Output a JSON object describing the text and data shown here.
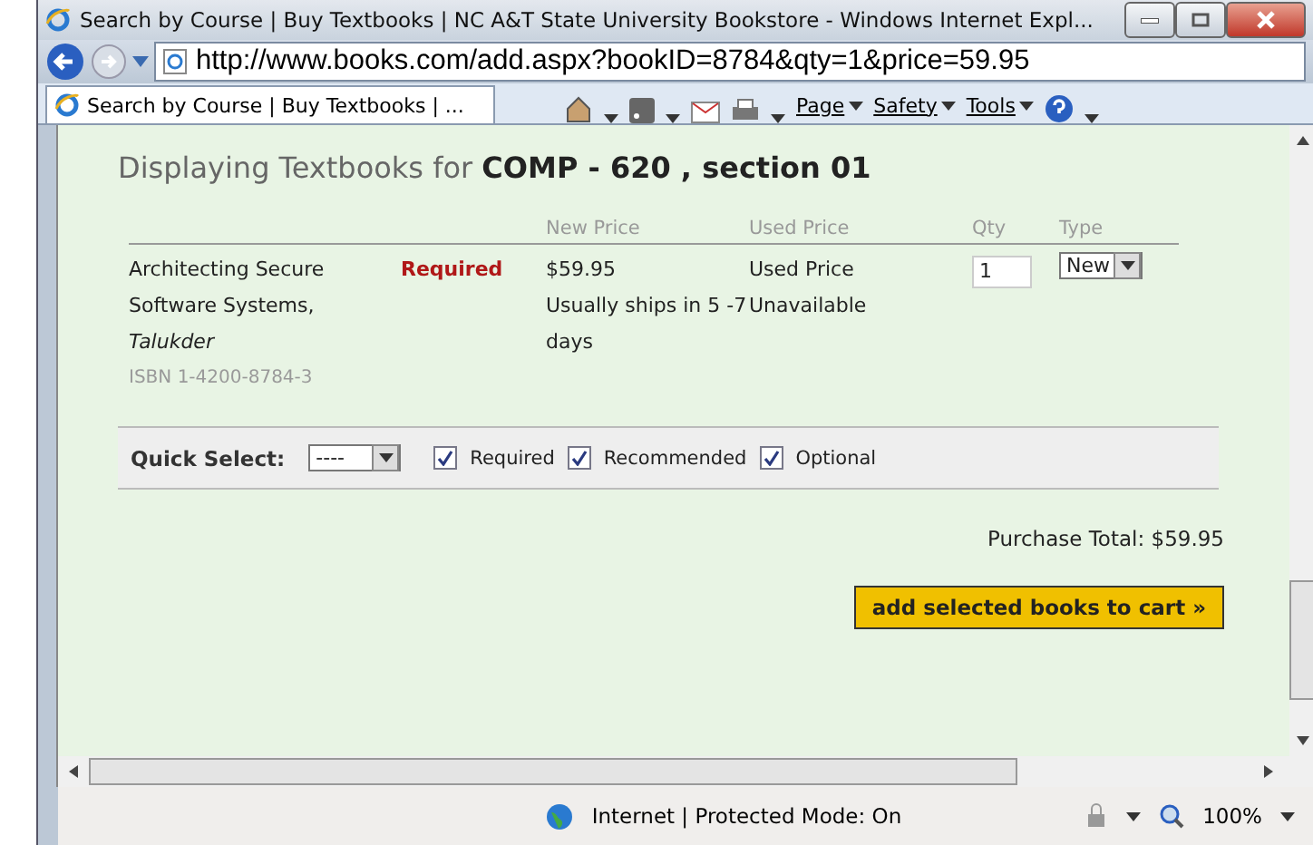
{
  "window": {
    "title": "Search by Course | Buy Textbooks | NC A&T State University Bookstore - Windows Internet Expl..."
  },
  "address_bar": {
    "url": "http://www.books.com/add.aspx?bookID=8784&qty=1&price=59.95"
  },
  "tab": {
    "title": "Search by Course | Buy Textbooks | ...",
    "selected": true
  },
  "command_bar": [
    "Page",
    "Safety",
    "Tools"
  ],
  "heading": "Displaying Textbooks for **COMP - 620 , section 01**",
  "table": {
    "columns": [
      "New Price",
      "Used Price",
      "Qty",
      "Type"
    ],
    "rows": [
      {
        "title": "Architecting Secure Software Systems, *Talukder*",
        "isbn": "ISBN 1-4200-8784-3",
        "requirement": "Required",
        "new_price": "$59.95",
        "shipping": "Usually ships in 5 -7 days",
        "used_price": "Used Price Unavailable",
        "qty": "1",
        "type": "New"
      }
    ]
  },
  "quick_select": {
    "label": "Quick Select:",
    "value": "----",
    "filters": [
      {
        "label": "Required",
        "checked": true
      },
      {
        "label": "Recommended",
        "checked": true
      },
      {
        "label": "Optional",
        "checked": true
      }
    ]
  },
  "total": "Purchase Total: $59.95",
  "cart_button": "add selected books to cart »",
  "status_bar": {
    "zone": "Internet | Protected Mode: On",
    "zoom": "100%"
  }
}
